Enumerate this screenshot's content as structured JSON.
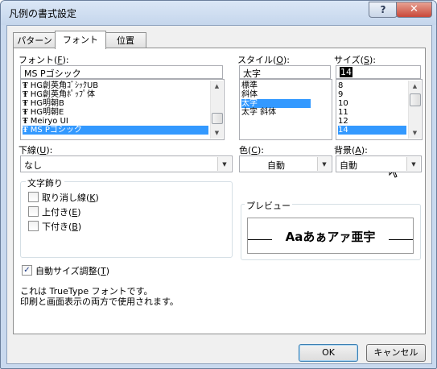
{
  "window": {
    "title": "凡例の書式設定",
    "help_glyph": "?",
    "close_glyph": "✕"
  },
  "tabs": [
    "パターン",
    "フォント",
    "位置"
  ],
  "font": {
    "label": "フォント(",
    "accel": "F",
    "label_end": "):",
    "value": "MS Pゴシック",
    "tt_glyph": "Ŧ",
    "items": [
      "HG創英角ｺﾞｼｯｸUB",
      "HG創英角ﾎﾟｯﾌﾟ体",
      "HG明朝B",
      "HG明朝E",
      "Meiryo UI",
      "MS Pゴシック"
    ],
    "selected_index": 5
  },
  "style": {
    "label": "スタイル(",
    "accel": "O",
    "label_end": "):",
    "value": "太字",
    "items": [
      "標準",
      "斜体",
      "太字",
      "太字 斜体"
    ],
    "selected_index": 2
  },
  "size": {
    "label": "サイズ(",
    "accel": "S",
    "label_end": "):",
    "value": "14",
    "items": [
      "8",
      "9",
      "10",
      "11",
      "12",
      "14"
    ],
    "selected_index": 5
  },
  "underline": {
    "label": "下線(",
    "accel": "U",
    "label_end": "):",
    "value": "なし"
  },
  "color": {
    "label": "色(",
    "accel": "C",
    "label_end": "):",
    "value": "自動"
  },
  "background": {
    "label": "背景(",
    "accel": "A",
    "label_end": "):",
    "value": "自動"
  },
  "effects": {
    "title": "文字飾り",
    "items": [
      {
        "label": "取り消し線(",
        "accel": "K",
        "label_end": ")",
        "checked": false
      },
      {
        "label": "上付き(",
        "accel": "E",
        "label_end": ")",
        "checked": false
      },
      {
        "label": "下付き(",
        "accel": "B",
        "label_end": ")",
        "checked": false
      }
    ]
  },
  "preview": {
    "title": "プレビュー",
    "sample": "Aaあぁアァ亜宇"
  },
  "autoscale": {
    "label": "自動サイズ調整(",
    "accel": "T",
    "label_end": ")",
    "checked": true
  },
  "info": {
    "line1": "これは TrueType フォントです。",
    "line2": "印刷と画面表示の両方で使用されます。"
  },
  "buttons": {
    "ok": "OK",
    "cancel": "キャンセル"
  },
  "glyphs": {
    "arrow_down": "▼",
    "arrow_up": "▲",
    "check": "✓"
  },
  "colors": {
    "selection": "#3399ff",
    "frame": "#c9d9ee",
    "close": "#c9483a"
  }
}
